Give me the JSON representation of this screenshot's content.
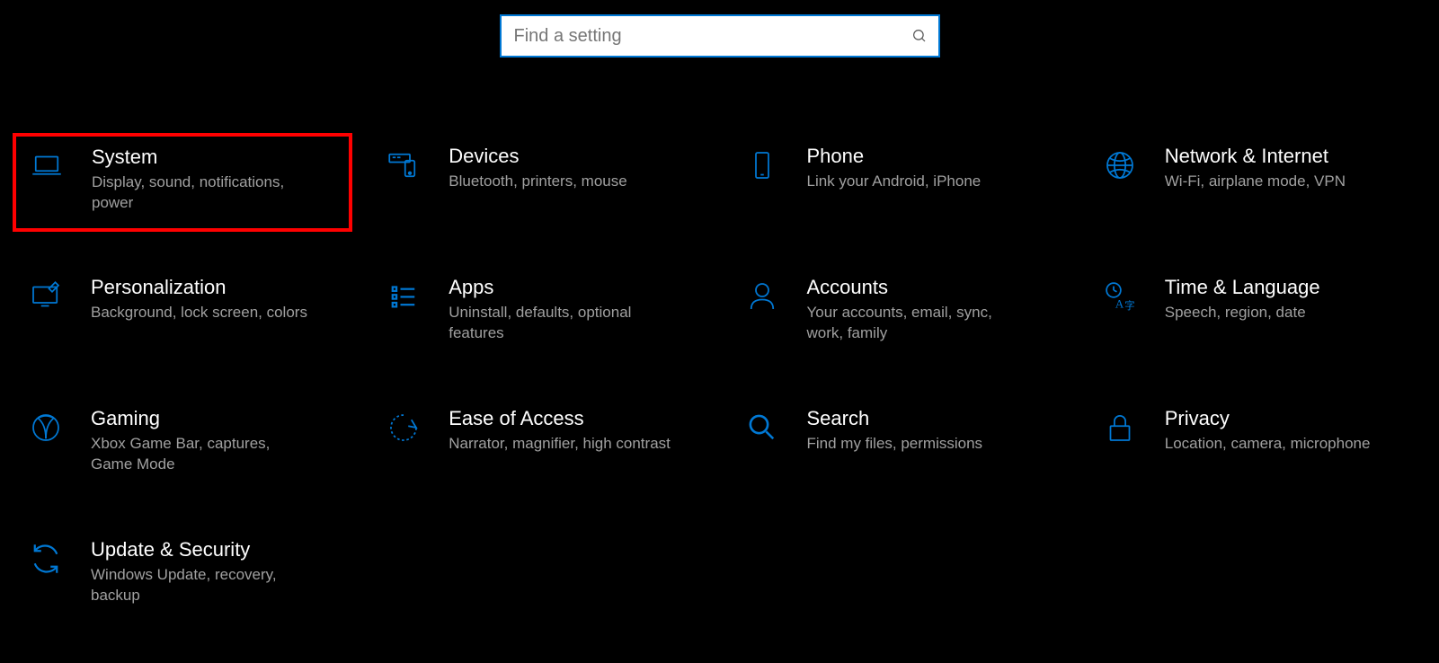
{
  "search": {
    "placeholder": "Find a setting"
  },
  "accent": "#0078d4",
  "tiles": [
    {
      "id": "system",
      "title": "System",
      "desc": "Display, sound, notifications, power",
      "highlight": true
    },
    {
      "id": "devices",
      "title": "Devices",
      "desc": "Bluetooth, printers, mouse"
    },
    {
      "id": "phone",
      "title": "Phone",
      "desc": "Link your Android, iPhone"
    },
    {
      "id": "network",
      "title": "Network & Internet",
      "desc": "Wi-Fi, airplane mode, VPN"
    },
    {
      "id": "personalization",
      "title": "Personalization",
      "desc": "Background, lock screen, colors"
    },
    {
      "id": "apps",
      "title": "Apps",
      "desc": "Uninstall, defaults, optional features"
    },
    {
      "id": "accounts",
      "title": "Accounts",
      "desc": "Your accounts, email, sync, work, family"
    },
    {
      "id": "time-language",
      "title": "Time & Language",
      "desc": "Speech, region, date"
    },
    {
      "id": "gaming",
      "title": "Gaming",
      "desc": "Xbox Game Bar, captures, Game Mode"
    },
    {
      "id": "ease-of-access",
      "title": "Ease of Access",
      "desc": "Narrator, magnifier, high contrast"
    },
    {
      "id": "search",
      "title": "Search",
      "desc": "Find my files, permissions"
    },
    {
      "id": "privacy",
      "title": "Privacy",
      "desc": "Location, camera, microphone"
    },
    {
      "id": "update-security",
      "title": "Update & Security",
      "desc": "Windows Update, recovery, backup"
    }
  ]
}
